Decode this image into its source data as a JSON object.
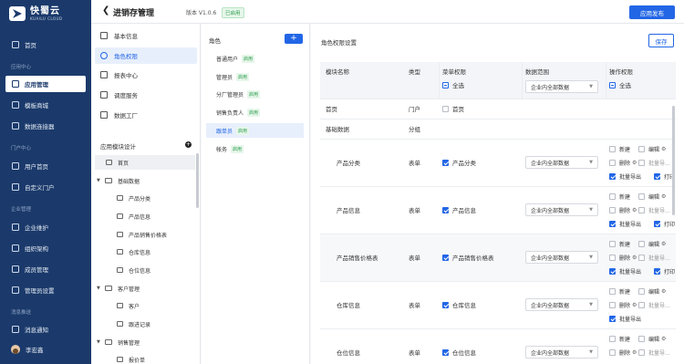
{
  "brand": {
    "name": "快蜀云",
    "sub": "KUAILU CLOUD"
  },
  "sidebar": {
    "home": "首页",
    "sec_app": "应用中心",
    "app_manage": "应用管理",
    "templates": "模板商城",
    "connector": "数据连接器",
    "sec_portal": "门户中心",
    "user_home": "用户首页",
    "custom_portal": "自定义门户",
    "sec_ent": "企业管理",
    "ent_maint": "企业维护",
    "org": "组织架构",
    "members": "成员管理",
    "admin": "管理员设置",
    "sec_msg": "消息推送",
    "notify": "消息通知",
    "user": "李宏鑫"
  },
  "topbar": {
    "back": "❮",
    "title": "进销存管理",
    "version": "版本 V1.0.6",
    "status": "已启用",
    "publish": "应用发布"
  },
  "nav": {
    "items": [
      "基本信息",
      "角色权限",
      "报表中心",
      "调度服务",
      "数据工厂"
    ],
    "design_title": "应用模块设计",
    "tree": [
      "首页",
      "基础数据",
      "产品分类",
      "产品信息",
      "产品销售价格表",
      "仓库信息",
      "仓位信息",
      "客户管理",
      "客户",
      "跟进记录",
      "销售管理",
      "报价单"
    ]
  },
  "roles": {
    "title": "角色",
    "add": "+",
    "items": [
      {
        "name": "普通用户",
        "status": "启用"
      },
      {
        "name": "管理员",
        "status": "启用"
      },
      {
        "name": "分厂管理员",
        "status": "启用"
      },
      {
        "name": "销售负责人",
        "status": "启用"
      },
      {
        "name": "跟单员",
        "status": "启用"
      },
      {
        "name": "帐务",
        "status": "启用"
      }
    ]
  },
  "main": {
    "title": "角色权限设置",
    "save": "保存",
    "headers": {
      "module": "模块名称",
      "type": "类型",
      "menu": "菜单权限",
      "scope": "数据范围",
      "ops": "操作权限",
      "all": "全选",
      "scope_default": "企业内全部数据"
    },
    "rows": [
      {
        "module": "首页",
        "type": "门户",
        "menu": "首页"
      },
      {
        "module": "基础数据",
        "type": "分组",
        "menu": ""
      },
      {
        "module": "产品分类",
        "type": "表单",
        "menu": "产品分类",
        "scope": "企业内全部数据"
      },
      {
        "module": "产品信息",
        "type": "表单",
        "menu": "产品信息",
        "scope": "企业内全部数据"
      },
      {
        "module": "产品销售价格表",
        "type": "表单",
        "menu": "产品销售价格表",
        "scope": "企业内全部数据"
      },
      {
        "module": "仓库信息",
        "type": "表单",
        "menu": "仓库信息",
        "scope": "企业内全部数据"
      },
      {
        "module": "仓位信息",
        "type": "表单",
        "menu": "仓位信息",
        "scope": "企业内全部数据"
      }
    ],
    "op_labels": {
      "create": "新建",
      "edit": "编辑",
      "del": "删除",
      "batch_up": "批量导...",
      "batch_export": "批量导出",
      "print": "打印"
    }
  }
}
